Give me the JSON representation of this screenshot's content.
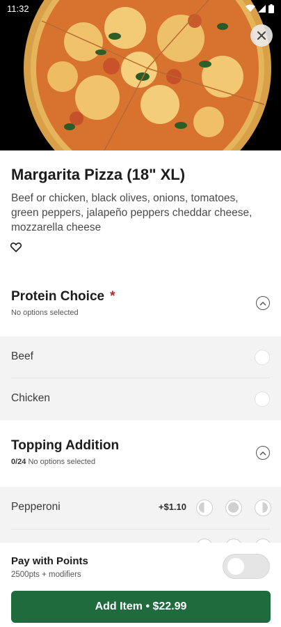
{
  "status_bar": {
    "time": "11:32",
    "icons": [
      "wifi-icon",
      "cell-signal-icon",
      "battery-icon"
    ]
  },
  "item": {
    "name": "Margarita Pizza (18\" XL)",
    "description": "Beef or chicken, black olives, onions, tomatoes, green peppers, jalapeño peppers cheddar cheese, mozzarella cheese"
  },
  "sections": [
    {
      "title": "Protein Choice",
      "required_mark": "*",
      "subtitle": "No options selected",
      "options": [
        {
          "label": "Beef"
        },
        {
          "label": "Chicken"
        }
      ]
    },
    {
      "title": "Topping Addition",
      "count": "0/24",
      "subtitle": "No options selected",
      "options": [
        {
          "label": "Pepperoni",
          "price": "+$1.10"
        }
      ]
    }
  ],
  "footer": {
    "pay_label": "Pay with Points",
    "pay_sub": "2500pts + modifiers",
    "toggle_on": false,
    "add_button": "Add Item • $22.99"
  },
  "colors": {
    "primary": "#1f6b3d",
    "required": "#c0222b",
    "option_bg": "#f3f3f3"
  }
}
